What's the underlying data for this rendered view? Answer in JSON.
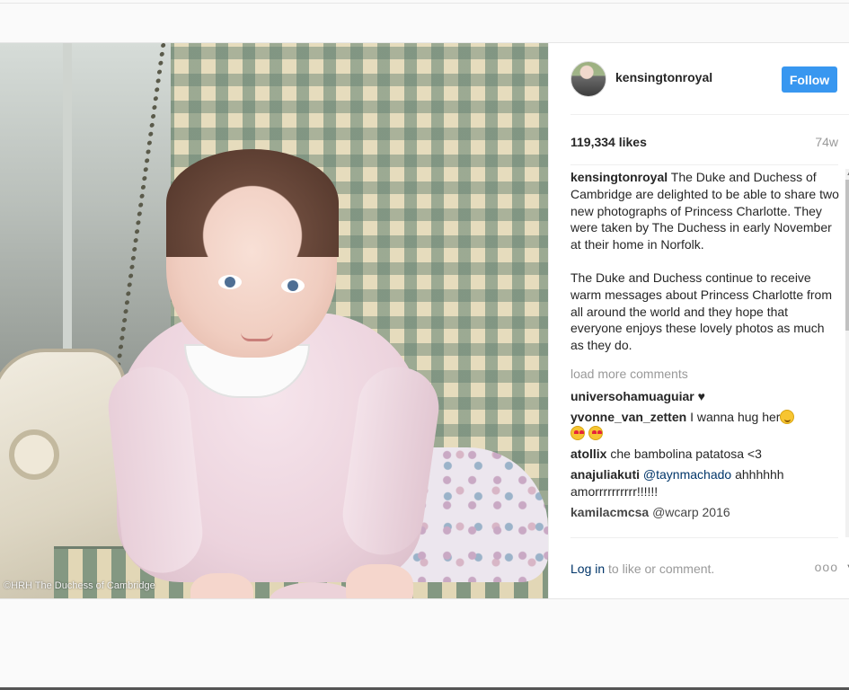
{
  "post": {
    "photo_credit": "©HRH The Duchess of Cambridge",
    "header": {
      "username": "kensingtonroyal",
      "follow_label": "Follow",
      "avatar_icon": "profile-avatar"
    },
    "likes": "119,334 likes",
    "age": "74w",
    "caption": {
      "username": "kensingtonroyal",
      "paragraph_1": "The Duke and Duchess of Cambridge are delighted to be able to share two new photographs of Princess Charlotte. They were taken by The Duchess in early November at their home in Norfolk.",
      "paragraph_2": "The Duke and Duchess continue to receive warm messages about Princess Charlotte from all around the world and they hope that everyone enjoys these lovely photos as much as they do."
    },
    "load_more": "load more comments",
    "comments": [
      {
        "user": "universohamuaguiar",
        "text": "♥"
      },
      {
        "user": "yvonne_van_zetten",
        "text": "I wanna hug her"
      },
      {
        "user": "atollix",
        "text": "che bambolina patatosa <3"
      },
      {
        "user": "anajuliakuti",
        "mention": "@taynmachado",
        "text": "ahhhhhh amorrrrrrrrrr!!!!!!"
      },
      {
        "user": "kamilacmcsa",
        "text": "@wcarp 2016"
      }
    ],
    "footer": {
      "login_link": "Log in",
      "login_rest": " to like or comment.",
      "more_label": "ooo"
    }
  }
}
